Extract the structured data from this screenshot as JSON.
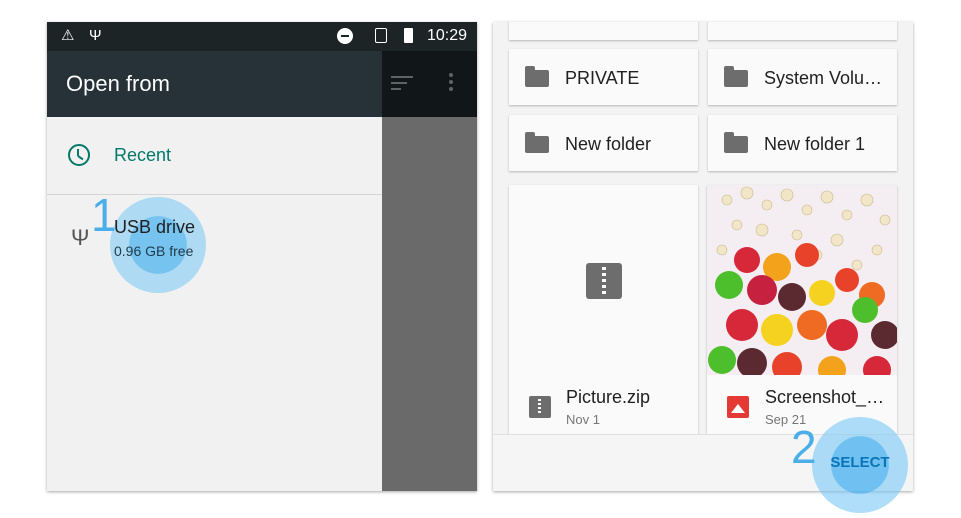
{
  "status_bar": {
    "time": "10:29",
    "icons": [
      "warning-icon",
      "usb-icon",
      "do-not-disturb-icon",
      "no-sim-icon",
      "battery-icon"
    ]
  },
  "left": {
    "title": "Open from",
    "recent_label": "Recent",
    "usb_title": "USB drive",
    "usb_subtitle": "0.96 GB free",
    "step_number": "1",
    "accent_color": "#00796b"
  },
  "right": {
    "folders": [
      {
        "name": "PRIVATE"
      },
      {
        "name": "System Volu…"
      },
      {
        "name": "New folder"
      },
      {
        "name": "New folder 1"
      }
    ],
    "files": [
      {
        "name": "Picture.zip",
        "date": "Nov 1",
        "icon": "zip-icon"
      },
      {
        "name": "Screenshot_…",
        "date": "Sep 21",
        "icon": "image-icon"
      }
    ],
    "select_label": "SELECT",
    "step_number": "2",
    "highlight_color": "#4aaee8"
  }
}
